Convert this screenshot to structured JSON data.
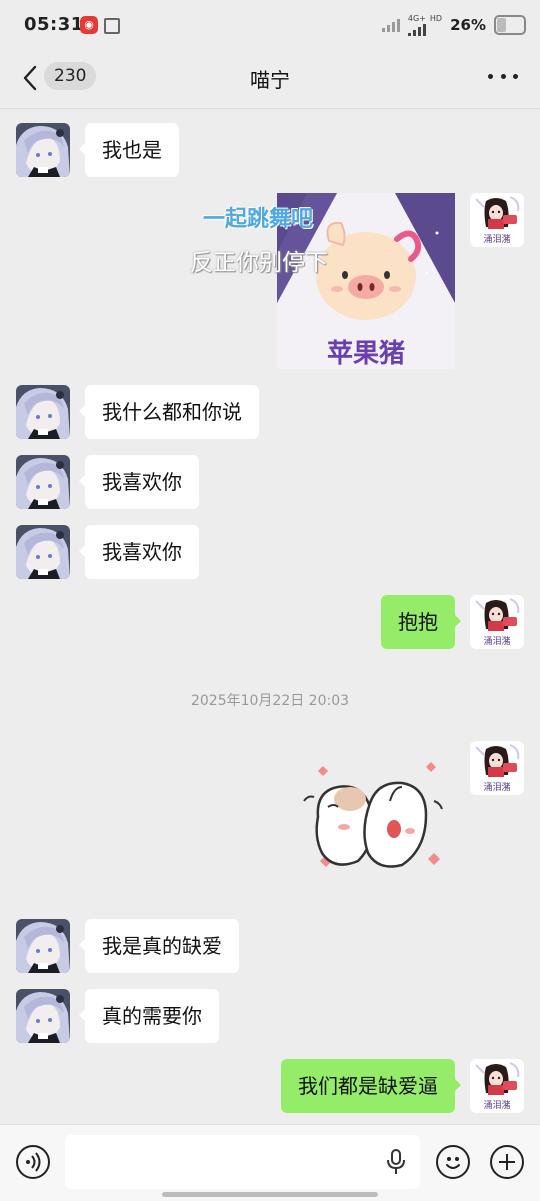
{
  "status_bar": {
    "time": "05:31",
    "network": "4G+",
    "hd": "HD",
    "battery": "26%",
    "battery_level": 0.26
  },
  "header": {
    "unread_count": "230",
    "title": "喵宁"
  },
  "sticker_pig": {
    "line1": "一起跳舞吧",
    "line2": "反正你别停下",
    "caption": "苹果猪"
  },
  "messages": {
    "m1": "我也是",
    "m2": "我什么都和你说",
    "m3": "我喜欢你",
    "m4": "我喜欢你",
    "m5": "抱抱",
    "m6": "我是真的缺爱",
    "m7": "真的需要你",
    "m8": "我们都是缺爱逼"
  },
  "timestamp": "2025年10月22日 20:03",
  "avatar_label": "涌泪潴",
  "colors": {
    "background": "#ededed",
    "incoming_bubble": "#ffffff",
    "outgoing_bubble": "#95ec69"
  }
}
